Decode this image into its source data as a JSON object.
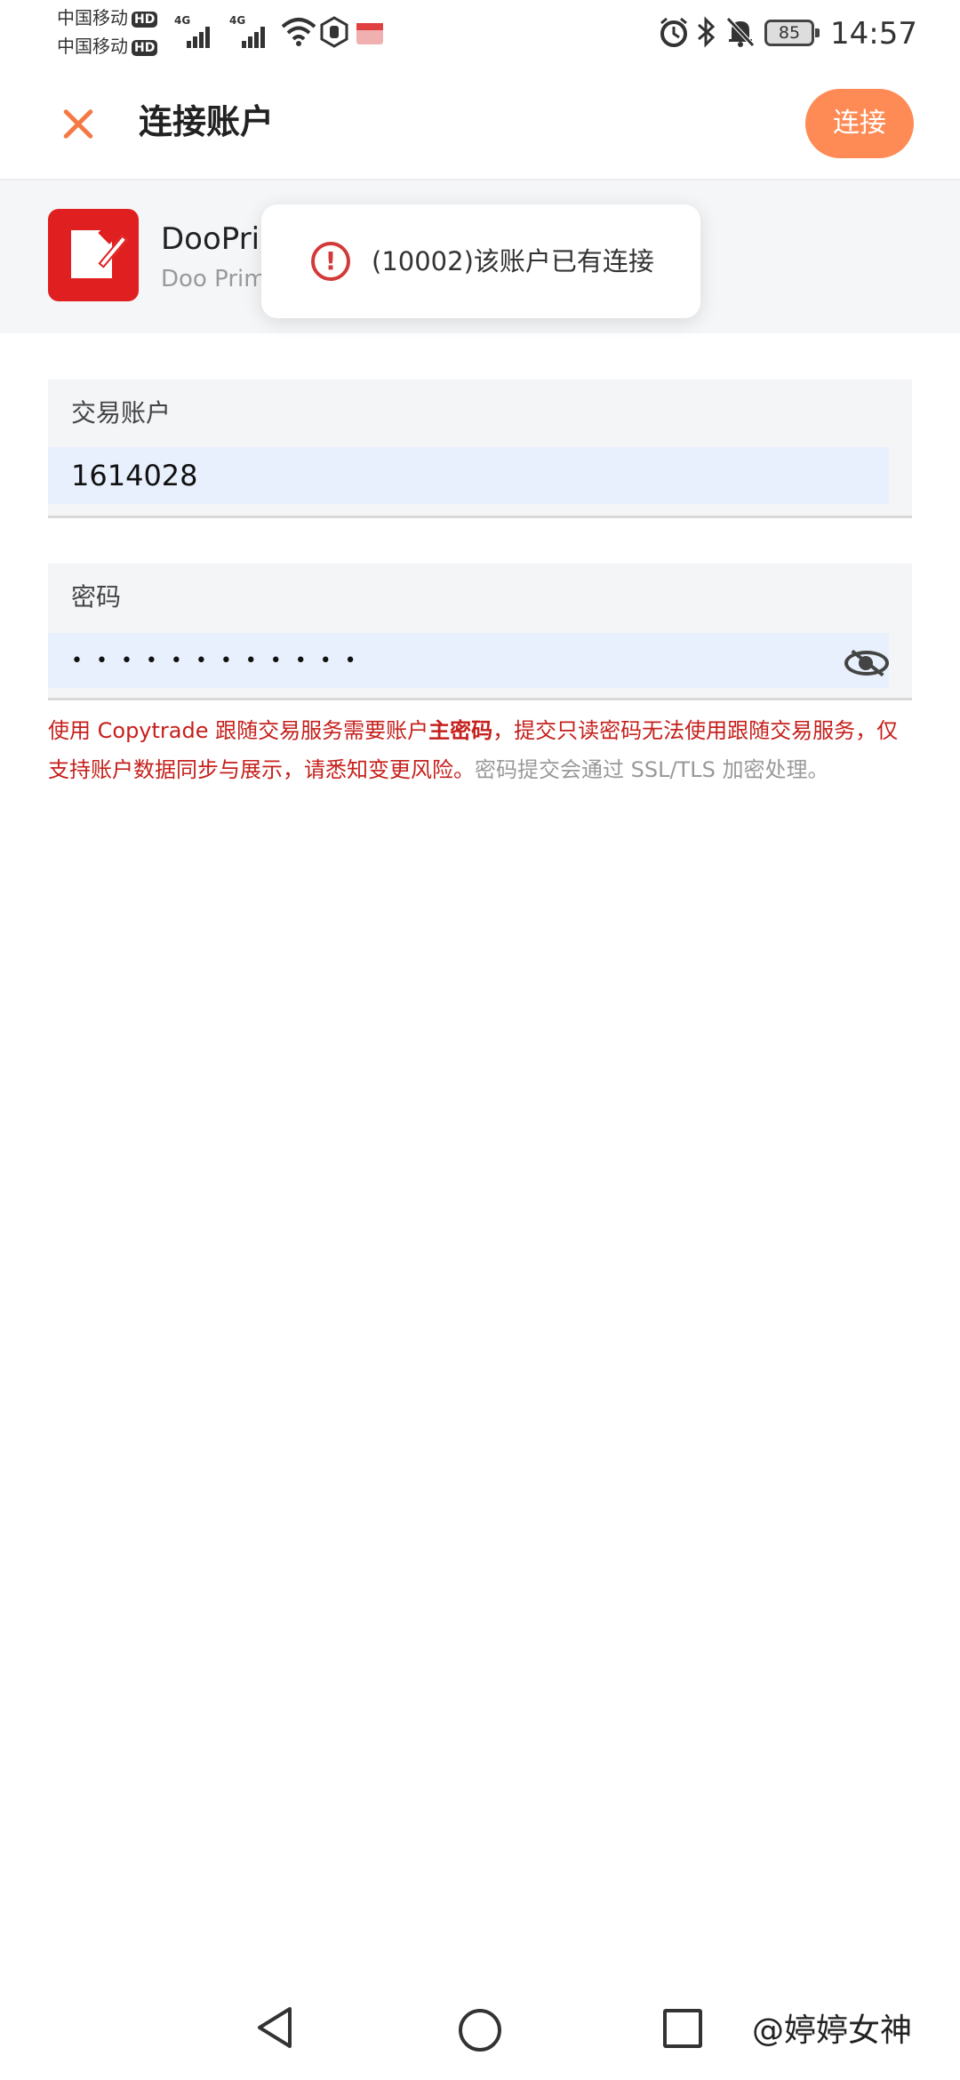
{
  "status_bar": {
    "carrier1": "中国移动",
    "carrier2": "中国移动",
    "hd": "HD",
    "network1": "4G",
    "network2": "4G",
    "battery": "85",
    "time": "14:57"
  },
  "header": {
    "title": "连接账户",
    "connect_label": "连接"
  },
  "broker": {
    "name": "DooPrim",
    "subtitle": "Doo Prim"
  },
  "toast": {
    "message": "(10002)该账户已有连接"
  },
  "form": {
    "account": {
      "label": "交易账户",
      "value": "1614028"
    },
    "password": {
      "label": "密码",
      "masked_value": "• • • • • • • • • • • •"
    }
  },
  "warning": {
    "part1": "使用 Copytrade 跟随交易服务需要账户",
    "bold": "主密码",
    "part2": "，提交只读密码无法使用跟随交易服务，仅支持账户数据同步与展示，请悉知变更风险。",
    "part3": "密码提交会通过 SSL/TLS 加密处理。"
  },
  "watermark": "@婷婷女神",
  "colors": {
    "accent": "#fe8b55",
    "close_icon": "#f37a45",
    "warning_red": "#c5201c",
    "input_bg": "#e8f0fd",
    "logo_red": "#e02020"
  },
  "icons": {
    "close": "close-icon",
    "toast": "error-icon",
    "password_toggle": "eye-off-icon",
    "status": [
      "wifi-icon",
      "alarm-icon",
      "bluetooth-icon",
      "mute-bell-icon"
    ]
  }
}
